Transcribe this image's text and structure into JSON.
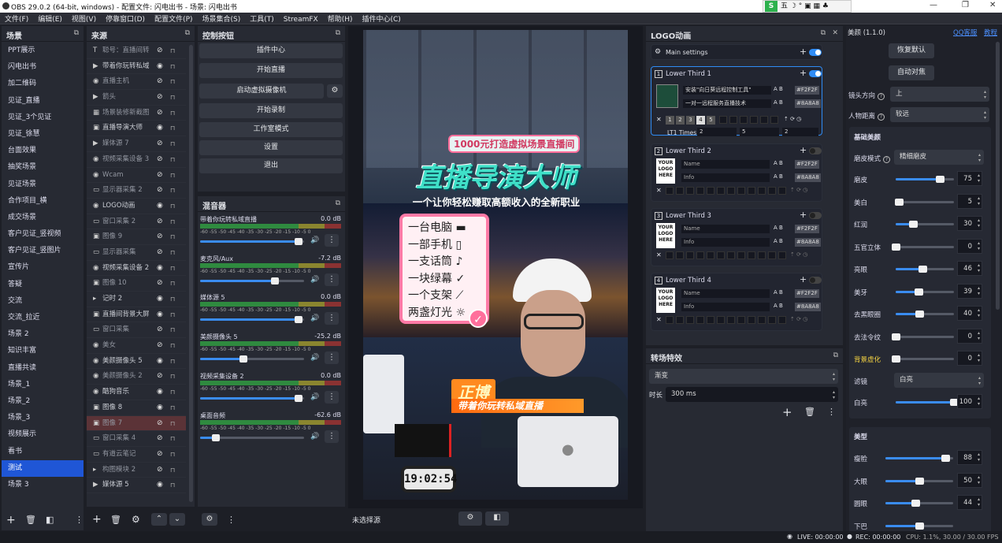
{
  "window": {
    "title": "OBS 29.0.2 (64-bit, windows) - 配置文件: 闪电出书 - 场景: 闪电出书",
    "ime": "五 ☽ ° ▣ ▦ ♣"
  },
  "menu": [
    "文件(F)",
    "编辑(E)",
    "视图(V)",
    "停靠窗口(D)",
    "配置文件(P)",
    "场景集合(S)",
    "工具(T)",
    "StreamFX",
    "帮助(H)",
    "插件中心(C)"
  ],
  "scenes": {
    "title": "场景",
    "items": [
      "PPT展示",
      "闪电出书",
      "加二维码",
      "见证_直播",
      "见证_3个见证",
      "见证_徐慧",
      "台面效果",
      "抽奖场景",
      "见证场景",
      "合作项目_横",
      "成交场景",
      "客户见证_竖视频",
      "客户见证_竖图片",
      "宣传片",
      "答疑",
      "交流",
      "交流_拉近",
      "场景 2",
      "知识丰富",
      "直播共读",
      "场景_1",
      "场景_2",
      "场景_3",
      "视频展示",
      "看书",
      "测试",
      "场景 3"
    ],
    "selected": "测试"
  },
  "sources": {
    "title": "来源",
    "items": [
      {
        "icon": "T",
        "label": "聪号：直播间转",
        "dim": true
      },
      {
        "icon": "▶",
        "label": "带着你玩转私域",
        "dim": false
      },
      {
        "icon": "◉",
        "label": "直播主机",
        "dim": true
      },
      {
        "icon": "▶",
        "label": "箭头",
        "dim": true
      },
      {
        "icon": "▦",
        "label": "场景装修新截图",
        "dim": true
      },
      {
        "icon": "▣",
        "label": "直播导演大师",
        "dim": false
      },
      {
        "icon": "▶",
        "label": "媒体源 7",
        "dim": true
      },
      {
        "icon": "◉",
        "label": "视频采集设备 3",
        "dim": true
      },
      {
        "icon": "◉",
        "label": "Wcam",
        "dim": true
      },
      {
        "icon": "▭",
        "label": "显示器采集 2",
        "dim": true
      },
      {
        "icon": "◉",
        "label": "LOGO动画",
        "dim": false
      },
      {
        "icon": "▭",
        "label": "窗口采集 2",
        "dim": true
      },
      {
        "icon": "▣",
        "label": "图像 9",
        "dim": true
      },
      {
        "icon": "▭",
        "label": "显示器采集",
        "dim": true
      },
      {
        "icon": "◉",
        "label": "视频采集设备 2",
        "dim": false
      },
      {
        "icon": "▣",
        "label": "图像 10",
        "dim": true
      },
      {
        "icon": "▸",
        "label": "记时 2",
        "dim": false
      },
      {
        "icon": "▣",
        "label": "直播间背景大屏",
        "dim": false
      },
      {
        "icon": "▭",
        "label": "窗口采集",
        "dim": true
      },
      {
        "icon": "◉",
        "label": "美女",
        "dim": true
      },
      {
        "icon": "◉",
        "label": "美颜摄像头 5",
        "dim": false
      },
      {
        "icon": "◉",
        "label": "美颜摄像头 2",
        "dim": true
      },
      {
        "icon": "◉",
        "label": "酷狗音乐",
        "dim": false
      },
      {
        "icon": "▣",
        "label": "图像 8",
        "dim": false
      },
      {
        "icon": "▣",
        "label": "图像 7",
        "dim": true
      },
      {
        "icon": "▭",
        "label": "窗口采集 4",
        "dim": true
      },
      {
        "icon": "▭",
        "label": "有道云笔记",
        "dim": true
      },
      {
        "icon": "▸",
        "label": "构图模块 2",
        "dim": true
      },
      {
        "icon": "▶",
        "label": "媒体源 5",
        "dim": false
      }
    ],
    "selected_index": 24
  },
  "controls": {
    "title": "控制按钮",
    "buttons": [
      "插件中心",
      "开始直播",
      "启动虚拟摄像机",
      "开始录制",
      "工作室模式",
      "设置",
      "退出"
    ]
  },
  "mixer": {
    "title": "混音器",
    "ticks": "-60 -55 -50 -45 -40 -35 -30 -25 -20 -15 -10 -5 0",
    "channels": [
      {
        "name": "带着你玩转私域直播",
        "db": "0.0 dB",
        "level": 0.95
      },
      {
        "name": "麦克风/Aux",
        "db": "-7.2 dB",
        "level": 0.72
      },
      {
        "name": "媒体源 5",
        "db": "0.0 dB",
        "level": 0.95
      },
      {
        "name": "美颜摄像头 5",
        "db": "-25.2 dB",
        "level": 0.42
      },
      {
        "name": "视频采集设备 2",
        "db": "0.0 dB",
        "level": 0.95
      },
      {
        "name": "桌面音频",
        "db": "-62.6 dB",
        "level": 0.15
      }
    ]
  },
  "preview": {
    "banner_top": "1000元打造虚拟场景直播间",
    "headline": "直播导演大师",
    "subline": "一个让你轻松赚取高额收入的全新职业",
    "list": [
      "一台电脑 ▬",
      "一部手机 ▯",
      "一支话筒 ♪",
      "一块绿幕 ✓",
      "一个支架 ⟋",
      "两盏灯光 ☼"
    ],
    "name_tag": "正博",
    "slogan": "带着你玩转私域直播",
    "clock": "19:02:54"
  },
  "preview_footer": {
    "status": "未选择源"
  },
  "logo_anim": {
    "title": "LOGO动画",
    "main_settings": "Main settings",
    "lower_thirds": [
      {
        "num": "1",
        "title": "Lower Third 1",
        "name": "安装\"向日葵远程控制工具\"",
        "info": "一对一远程服务直播技术",
        "color1": "#F2F2F",
        "color2": "#8A8A8",
        "active": true,
        "times_label": "LT1 Times",
        "times": "2",
        "v2": "5",
        "v3": "2"
      },
      {
        "num": "2",
        "title": "Lower Third 2",
        "name": "Name",
        "info": "Info",
        "color1": "#F2F2F",
        "color2": "#8A8A8",
        "active": false
      },
      {
        "num": "3",
        "title": "Lower Third 3",
        "name": "Name",
        "info": "Info",
        "color1": "#F2F2F",
        "color2": "#8A8A8",
        "active": false
      },
      {
        "num": "4",
        "title": "Lower Third 4",
        "name": "Name",
        "info": "Info",
        "color1": "#F2F2F",
        "color2": "#8A8A8",
        "active": false
      }
    ],
    "logo_text": [
      "YOUR",
      "LOGO",
      "HERE"
    ],
    "page_buttons": [
      "1",
      "2",
      "3",
      "4",
      "5"
    ]
  },
  "transition": {
    "title": "转场特效",
    "effect": "渐变",
    "duration_label": "时长",
    "duration": "300 ms"
  },
  "beauty": {
    "title": "美颜 (1.1.0)",
    "links": [
      "QQ客服",
      "教程"
    ],
    "buttons": [
      "恢复默认",
      "自动对焦"
    ],
    "camera_dir_label": "镜头方向",
    "camera_dir": "上",
    "distance_label": "人物距离",
    "distance": "较远",
    "basic_title": "基础美颜",
    "skin_mode_label": "磨皮模式",
    "skin_mode": "精细磨皮",
    "basic": [
      {
        "label": "磨皮",
        "value": "75",
        "frac": 0.75,
        "hl": false
      },
      {
        "label": "美白",
        "value": "5",
        "frac": 0.05,
        "hl": false
      },
      {
        "label": "红润",
        "value": "30",
        "frac": 0.3,
        "hl": false
      },
      {
        "label": "五官立体",
        "value": "0",
        "frac": 0,
        "hl": false
      },
      {
        "label": "亮眼",
        "value": "46",
        "frac": 0.46,
        "hl": false
      },
      {
        "label": "美牙",
        "value": "39",
        "frac": 0.39,
        "hl": false
      },
      {
        "label": "去黑眼圈",
        "value": "40",
        "frac": 0.4,
        "hl": false
      },
      {
        "label": "去法令纹",
        "value": "0",
        "frac": 0,
        "hl": false
      },
      {
        "label": "背景虚化",
        "value": "0",
        "frac": 0,
        "hl": true
      }
    ],
    "filter_label": "滤镜",
    "filter": "白亮",
    "white_label": "白亮",
    "white_value": "100",
    "white_frac": 1.0,
    "shape_title": "美型",
    "shape": [
      {
        "label": "瘦脸",
        "value": "88",
        "frac": 0.88
      },
      {
        "label": "大眼",
        "value": "50",
        "frac": 0.5
      },
      {
        "label": "圆眼",
        "value": "44",
        "frac": 0.44
      },
      {
        "label": "下巴",
        "value": "",
        "frac": 0.5
      }
    ]
  },
  "statusbar": {
    "live": "LIVE: 00:00:00",
    "rec": "REC: 00:00:00",
    "cpu": "CPU: 1.1%, 30.00 / 30.00 FPS"
  },
  "colors": {
    "accent": "#2f8cf5",
    "bg": "#1d1f26",
    "panel": "#272a33",
    "selected_scene": "#1f56d6",
    "selected_source": "#5b3337",
    "headline": "#3fe0c8",
    "pink": "#ff6f9c",
    "orange": "#ff7a1a"
  }
}
